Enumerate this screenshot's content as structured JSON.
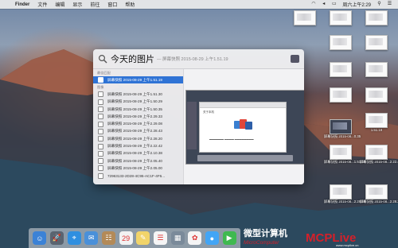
{
  "menubar": {
    "apple": "",
    "items": [
      "Finder",
      "文件",
      "编辑",
      "显示",
      "前往",
      "窗口",
      "帮助"
    ],
    "clock": "周六上午2:29"
  },
  "spotlight": {
    "query": "今天的图片",
    "hint": "— 屏幕快照 2015-08-29 上午1.51.19",
    "sections": {
      "top_hit": "最佳匹配",
      "images": "图像"
    },
    "top_hit": {
      "label": "屏幕快照 2015-08-29 上午1.51.19",
      "selected": true
    },
    "results": [
      "屏幕快照 2015-08-29 上午1.51.30",
      "屏幕快照 2015-08-29 上午1.50.29",
      "屏幕快照 2015-08-29 上午1.50.35",
      "屏幕快照 2015-08-29 上午2.29.33",
      "屏幕快照 2015-08-29 上午2.29.08",
      "屏幕快照 2015-08-29 上午2.28.43",
      "屏幕快照 2015-08-29 上午2.28.20",
      "屏幕快照 2015-08-29 上午2.22.42",
      "屏幕快照 2015-08-29 上午2.10.38",
      "屏幕快照 2015-08-29 上午2.05.40",
      "屏幕快照 2015-08-29 上午2.05.00",
      "72963133-2D28-4C95-AC1F-4F6..."
    ],
    "preview": {
      "window_title": "关于本机"
    }
  },
  "desktop": {
    "files": [
      {
        "label": "",
        "dark": false
      },
      {
        "label": "",
        "dark": false
      },
      {
        "label": "",
        "dark": false
      },
      {
        "label": "",
        "dark": false
      },
      {
        "label": "",
        "dark": false
      },
      {
        "label": "",
        "dark": false
      },
      {
        "label": "",
        "dark": false
      },
      {
        "label": "",
        "dark": false
      },
      {
        "label": "",
        "dark": false
      },
      {
        "label": "1.51.19",
        "dark": false
      },
      {
        "label": "屏幕快照 2015-08...0.35",
        "dark": true
      },
      {
        "label": "屏幕快照 2015-08...1.51.30",
        "dark": false
      },
      {
        "label": "屏幕快照 2015-08...2.22.42",
        "dark": false
      },
      {
        "label": "屏幕快照 2015-08...2.28.20",
        "dark": false
      },
      {
        "label": "屏幕快照 2015-08...2.28.23",
        "dark": false
      }
    ]
  },
  "dock": {
    "apps": [
      {
        "name": "finder-icon",
        "glyph": "☺",
        "color": "#3b82d6"
      },
      {
        "name": "launchpad-icon",
        "glyph": "🚀",
        "color": "#5a6470"
      },
      {
        "name": "safari-icon",
        "glyph": "⌖",
        "color": "#2f8fe0"
      },
      {
        "name": "mail-icon",
        "glyph": "✉",
        "color": "#4a90d9"
      },
      {
        "name": "contacts-icon",
        "glyph": "☷",
        "color": "#b38a58"
      },
      {
        "name": "calendar-icon",
        "glyph": "29",
        "color": "#f2f2f2"
      },
      {
        "name": "notes-icon",
        "glyph": "✎",
        "color": "#f1d46a"
      },
      {
        "name": "reminders-icon",
        "glyph": "☰",
        "color": "#f5f5f5"
      },
      {
        "name": "photos-viewer-icon",
        "glyph": "▦",
        "color": "#7a8a9a"
      },
      {
        "name": "photos-icon",
        "glyph": "✿",
        "color": "#f5f5f5"
      },
      {
        "name": "messages-icon",
        "glyph": "●",
        "color": "#42a5f5"
      },
      {
        "name": "facetime-icon",
        "glyph": "▶",
        "color": "#3fb950"
      }
    ]
  },
  "watermark": {
    "title": "微型计算机",
    "subtitle": "MicroComputer",
    "brand": "MCPLive",
    "brand_sub": "www.mcplive.cn"
  },
  "colors": {
    "selection": "#2f73d5",
    "watermark_red": "#d4202a"
  }
}
